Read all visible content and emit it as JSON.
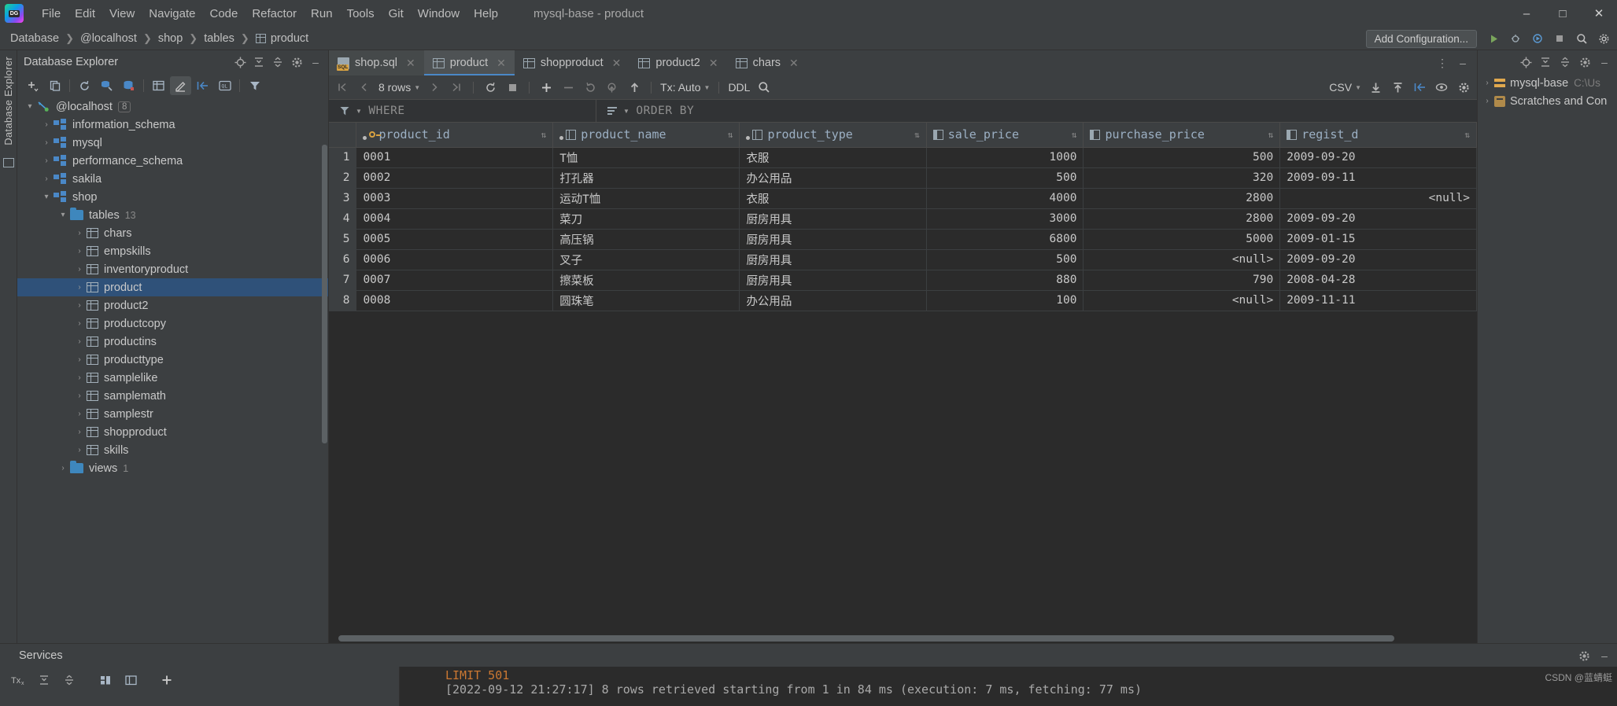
{
  "window": {
    "title": "mysql-base - product",
    "controls": [
      "minimize",
      "maximize",
      "close"
    ]
  },
  "menubar": {
    "items": [
      "File",
      "Edit",
      "View",
      "Navigate",
      "Code",
      "Refactor",
      "Run",
      "Tools",
      "Git",
      "Window",
      "Help"
    ]
  },
  "breadcrumb": {
    "items": [
      "Database",
      "@localhost",
      "shop",
      "tables",
      "product"
    ],
    "add_configuration_label": "Add Configuration..."
  },
  "explorer": {
    "title": "Database Explorer",
    "tree": [
      {
        "label": "@localhost",
        "badge": "8",
        "icon": "connection-icon",
        "indent": 0,
        "arrow": "∨",
        "selected": false
      },
      {
        "label": "information_schema",
        "badge": "",
        "icon": "schema-icon",
        "indent": 1,
        "arrow": "›",
        "selected": false
      },
      {
        "label": "mysql",
        "badge": "",
        "icon": "schema-icon",
        "indent": 1,
        "arrow": "›",
        "selected": false
      },
      {
        "label": "performance_schema",
        "badge": "",
        "icon": "schema-icon",
        "indent": 1,
        "arrow": "›",
        "selected": false
      },
      {
        "label": "sakila",
        "badge": "",
        "icon": "schema-icon",
        "indent": 1,
        "arrow": "›",
        "selected": false
      },
      {
        "label": "shop",
        "badge": "",
        "icon": "schema-icon",
        "indent": 1,
        "arrow": "∨",
        "selected": false
      },
      {
        "label": "tables",
        "badge": "13",
        "icon": "folder-icon",
        "indent": 2,
        "arrow": "∨",
        "selected": false
      },
      {
        "label": "chars",
        "badge": "",
        "icon": "table-icon",
        "indent": 3,
        "arrow": "›",
        "selected": false
      },
      {
        "label": "empskills",
        "badge": "",
        "icon": "table-icon",
        "indent": 3,
        "arrow": "›",
        "selected": false
      },
      {
        "label": "inventoryproduct",
        "badge": "",
        "icon": "table-icon",
        "indent": 3,
        "arrow": "›",
        "selected": false
      },
      {
        "label": "product",
        "badge": "",
        "icon": "table-icon",
        "indent": 3,
        "arrow": "›",
        "selected": true
      },
      {
        "label": "product2",
        "badge": "",
        "icon": "table-icon",
        "indent": 3,
        "arrow": "›",
        "selected": false
      },
      {
        "label": "productcopy",
        "badge": "",
        "icon": "table-icon",
        "indent": 3,
        "arrow": "›",
        "selected": false
      },
      {
        "label": "productins",
        "badge": "",
        "icon": "table-icon",
        "indent": 3,
        "arrow": "›",
        "selected": false
      },
      {
        "label": "producttype",
        "badge": "",
        "icon": "table-icon",
        "indent": 3,
        "arrow": "›",
        "selected": false
      },
      {
        "label": "samplelike",
        "badge": "",
        "icon": "table-icon",
        "indent": 3,
        "arrow": "›",
        "selected": false
      },
      {
        "label": "samplemath",
        "badge": "",
        "icon": "table-icon",
        "indent": 3,
        "arrow": "›",
        "selected": false
      },
      {
        "label": "samplestr",
        "badge": "",
        "icon": "table-icon",
        "indent": 3,
        "arrow": "›",
        "selected": false
      },
      {
        "label": "shopproduct",
        "badge": "",
        "icon": "table-icon",
        "indent": 3,
        "arrow": "›",
        "selected": false
      },
      {
        "label": "skills",
        "badge": "",
        "icon": "table-icon",
        "indent": 3,
        "arrow": "›",
        "selected": false
      },
      {
        "label": "views",
        "badge": "1",
        "icon": "folder-icon",
        "indent": 2,
        "arrow": "›",
        "selected": false
      }
    ]
  },
  "tabs": [
    {
      "label": "shop.sql",
      "icon": "sql-file-icon",
      "state": "dim"
    },
    {
      "label": "product",
      "icon": "table-icon",
      "state": "active"
    },
    {
      "label": "shopproduct",
      "icon": "table-icon",
      "state": "normal"
    },
    {
      "label": "product2",
      "icon": "table-icon",
      "state": "normal"
    },
    {
      "label": "chars",
      "icon": "table-icon",
      "state": "normal"
    }
  ],
  "gridbar": {
    "rows_label": "8 rows",
    "tx_label": "Tx: Auto",
    "ddl_label": "DDL",
    "csv_label": "CSV"
  },
  "filters": {
    "where_label": "WHERE",
    "order_by_label": "ORDER BY"
  },
  "grid": {
    "columns": [
      {
        "name": "product_id",
        "icon": "primary-key-icon",
        "align": "left"
      },
      {
        "name": "product_name",
        "icon": "column-icon",
        "align": "left"
      },
      {
        "name": "product_type",
        "icon": "column-icon",
        "align": "left"
      },
      {
        "name": "sale_price",
        "icon": "numeric-column-icon",
        "align": "right"
      },
      {
        "name": "purchase_price",
        "icon": "numeric-column-icon",
        "align": "right"
      },
      {
        "name": "regist_d",
        "icon": "date-column-icon",
        "align": "left"
      }
    ],
    "rows": [
      {
        "n": "1",
        "product_id": "0001",
        "product_name": "T恤",
        "product_type": "衣服",
        "sale_price": "1000",
        "purchase_price": "500",
        "regist_date": "2009-09-20"
      },
      {
        "n": "2",
        "product_id": "0002",
        "product_name": "打孔器",
        "product_type": "办公用品",
        "sale_price": "500",
        "purchase_price": "320",
        "regist_date": "2009-09-11"
      },
      {
        "n": "3",
        "product_id": "0003",
        "product_name": "运动T恤",
        "product_type": "衣服",
        "sale_price": "4000",
        "purchase_price": "2800",
        "regist_date": "<null>"
      },
      {
        "n": "4",
        "product_id": "0004",
        "product_name": "菜刀",
        "product_type": "厨房用具",
        "sale_price": "3000",
        "purchase_price": "2800",
        "regist_date": "2009-09-20"
      },
      {
        "n": "5",
        "product_id": "0005",
        "product_name": "高压锅",
        "product_type": "厨房用具",
        "sale_price": "6800",
        "purchase_price": "5000",
        "regist_date": "2009-01-15"
      },
      {
        "n": "6",
        "product_id": "0006",
        "product_name": "叉子",
        "product_type": "厨房用具",
        "sale_price": "500",
        "purchase_price": "<null>",
        "regist_date": "2009-09-20"
      },
      {
        "n": "7",
        "product_id": "0007",
        "product_name": "擦菜板",
        "product_type": "厨房用具",
        "sale_price": "880",
        "purchase_price": "790",
        "regist_date": "2008-04-28"
      },
      {
        "n": "8",
        "product_id": "0008",
        "product_name": "圆珠笔",
        "product_type": "办公用品",
        "sale_price": "100",
        "purchase_price": "<null>",
        "regist_date": "2009-11-11"
      }
    ]
  },
  "right_panel": {
    "items": [
      {
        "label": "mysql-base",
        "path": "C:\\Us",
        "icon": "db-project-icon",
        "arrow": "›"
      },
      {
        "label": "Scratches and Con",
        "path": "",
        "icon": "scratches-icon",
        "arrow": "›"
      }
    ]
  },
  "bottom": {
    "services_label": "Services",
    "console_lines": [
      {
        "text": "LIMIT 501",
        "type": "sql"
      },
      {
        "text": "[2022-09-12 21:27:17] 8 rows retrieved starting from 1 in 84 ms (execution: 7 ms, fetching: 77 ms)",
        "type": "output"
      }
    ],
    "watermark": "CSDN @蓝蜻蜓"
  },
  "vertical_strip": {
    "label": "Database Explorer"
  },
  "colors": {
    "accent": "#4a88c7",
    "selection": "#2f5179",
    "panel": "#3c3f41",
    "grid_bg": "#2b2b2b",
    "key_icon": "#d8a241"
  }
}
